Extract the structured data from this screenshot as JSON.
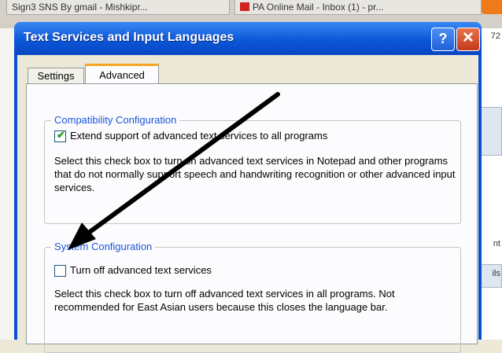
{
  "browser": {
    "tab1": "Sign3 SNS By gmail - Mishkipr...",
    "tab2": "PA Online Mail - Inbox (1) - pr...",
    "right_text_1": "72",
    "right_text_2": "nt",
    "right_text_3": "ils"
  },
  "dialog": {
    "title": "Text Services and Input Languages",
    "help_label": "?",
    "close_label": "✕",
    "tabs": [
      {
        "label": "Settings",
        "active": false
      },
      {
        "label": "Advanced",
        "active": true
      }
    ],
    "compat": {
      "legend": "Compatibility Configuration",
      "checkbox_label": "Extend support of advanced text services to all programs",
      "checked": true,
      "description": "Select this check box to turn on advanced text services in Notepad and other programs that do not normally support speech and handwriting recognition or other advanced input services."
    },
    "system": {
      "legend": "System Configuration",
      "checkbox_label": "Turn off advanced text services",
      "checked": false,
      "description": "Select this check box to turn off advanced text services in all programs. Not recommended for East Asian users because this closes the language bar."
    }
  },
  "colors": {
    "title_bar": "#0b57d8",
    "legend_text": "#1b54d8",
    "active_tab_accent": "#f5a623",
    "close_button": "#c43a1c"
  }
}
